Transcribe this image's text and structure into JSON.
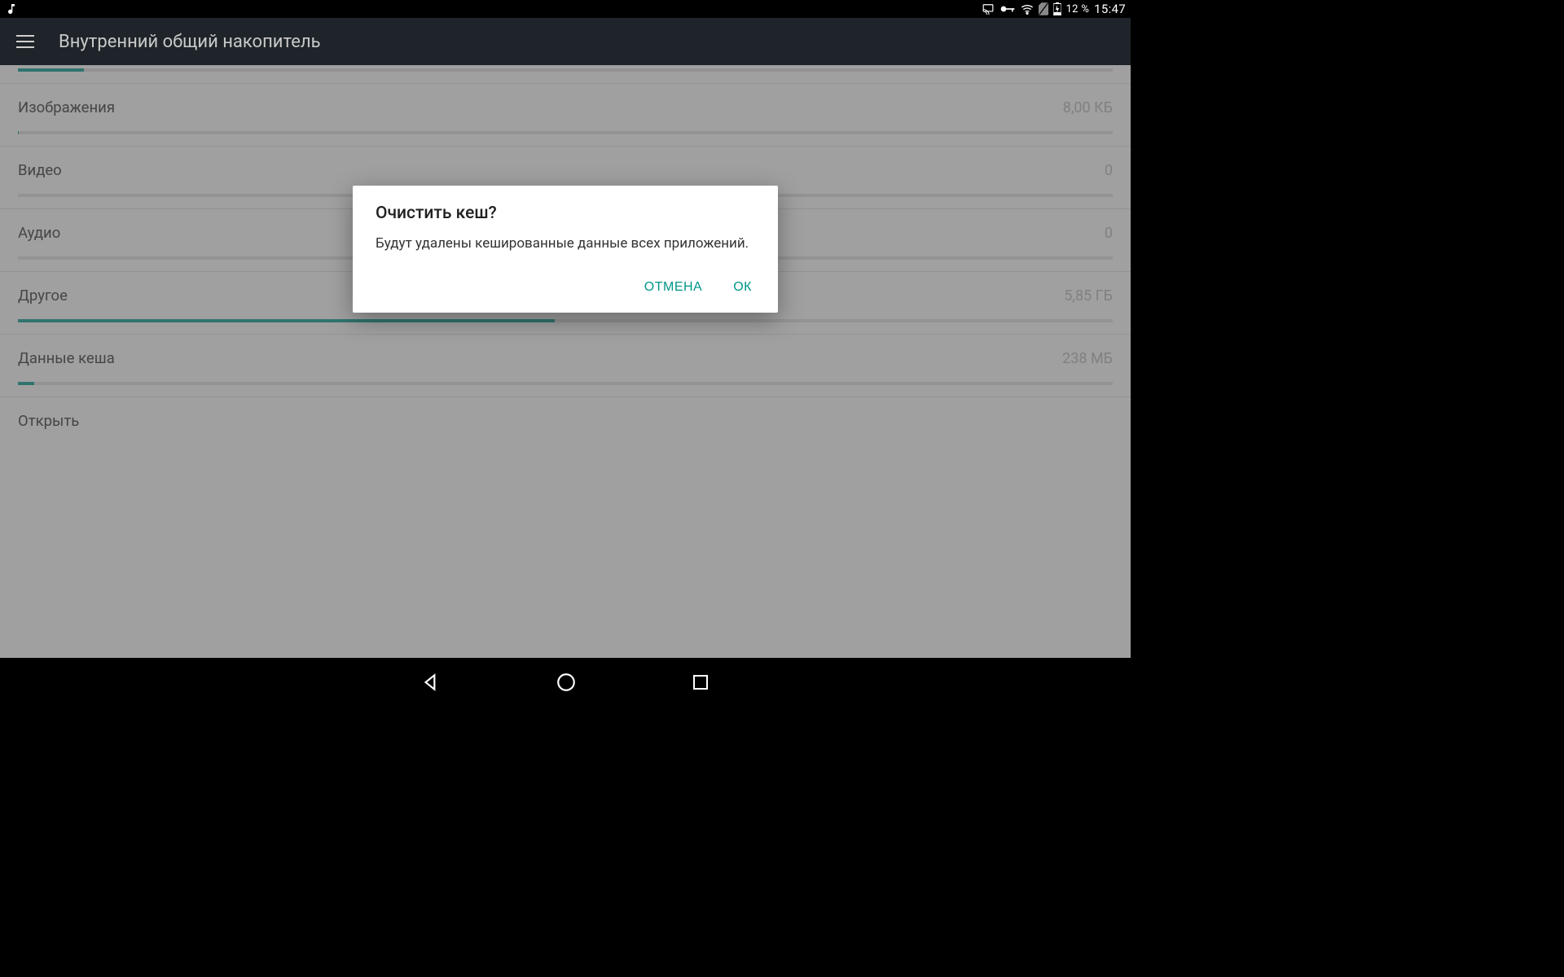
{
  "status": {
    "battery_pct": "12 %",
    "time": "15:47"
  },
  "appbar": {
    "title": "Внутренний общий накопитель"
  },
  "storage_items": [
    {
      "label": "",
      "value": "",
      "progress": 6,
      "partial_top": true
    },
    {
      "label": "Изображения",
      "value": "8,00 КБ",
      "progress": 0.1
    },
    {
      "label": "Видео",
      "value": "0",
      "progress": 0
    },
    {
      "label": "Аудио",
      "value": "0",
      "progress": 0
    },
    {
      "label": "Другое",
      "value": "5,85 ГБ",
      "progress": 49
    },
    {
      "label": "Данные кеша",
      "value": "238 МБ",
      "progress": 1.5
    },
    {
      "label": "Открыть",
      "value": "",
      "no_bar": true
    }
  ],
  "dialog": {
    "title": "Очистить кеш?",
    "body": "Будут удалены кешированные данные всех приложений.",
    "cancel": "ОТМЕНА",
    "ok": "ОК"
  }
}
